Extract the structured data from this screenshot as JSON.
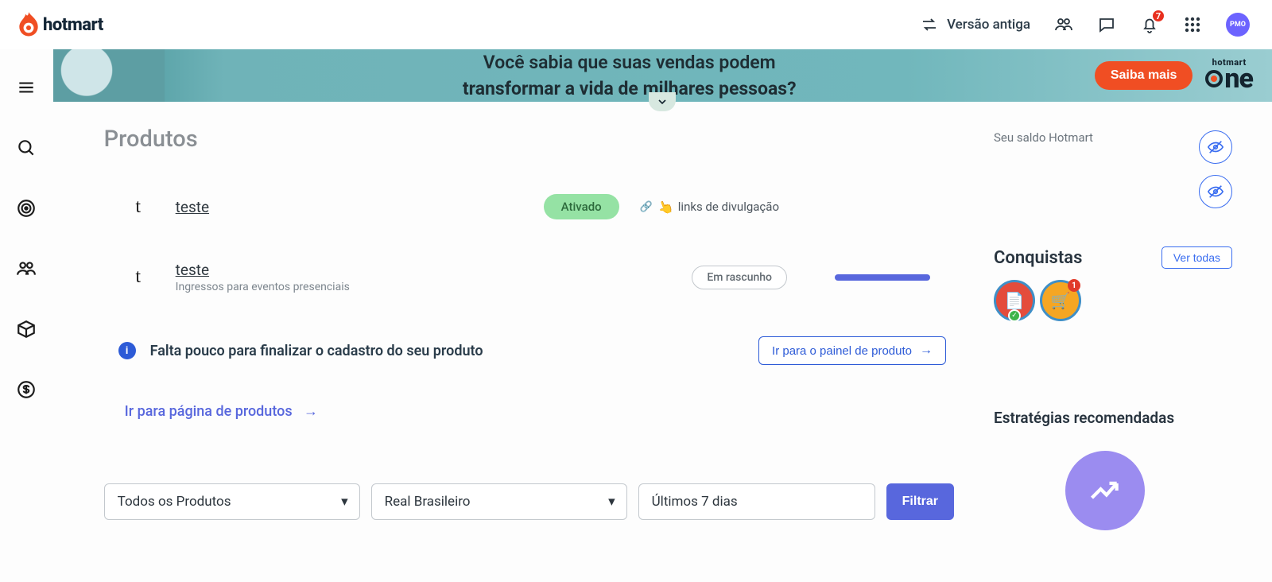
{
  "header": {
    "brand": "hotmart",
    "legacy_link": "Versão antiga",
    "notification_count": "7",
    "avatar_text": "PMO"
  },
  "banner": {
    "line1": "Você sabia que suas vendas podem",
    "line2": "transformar a vida de milhares pessoas?",
    "cta": "Saiba mais",
    "logo_top": "hotmart",
    "logo_bottom": "ne"
  },
  "page": {
    "title": "Produtos"
  },
  "products": [
    {
      "letter": "t",
      "name": "teste",
      "subtitle": "",
      "status": "Ativado",
      "status_style": "green",
      "links_label": "links de divulgação"
    },
    {
      "letter": "t",
      "name": "teste",
      "subtitle": "Ingressos para eventos presenciais",
      "status": "Em rascunho",
      "status_style": "outline"
    }
  ],
  "alert": {
    "message": "Falta pouco para finalizar o cadastro do seu produto",
    "button": "Ir para o painel de produto"
  },
  "product_page_link": "Ir para página de produtos",
  "filters": {
    "product": "Todos os Produtos",
    "currency": "Real Brasileiro",
    "period": "Últimos 7 dias",
    "button": "Filtrar"
  },
  "side": {
    "balance_label": "Seu saldo Hotmart",
    "achievements_title": "Conquistas",
    "view_all": "Ver todas",
    "strategies_title": "Estratégias recomendadas"
  }
}
